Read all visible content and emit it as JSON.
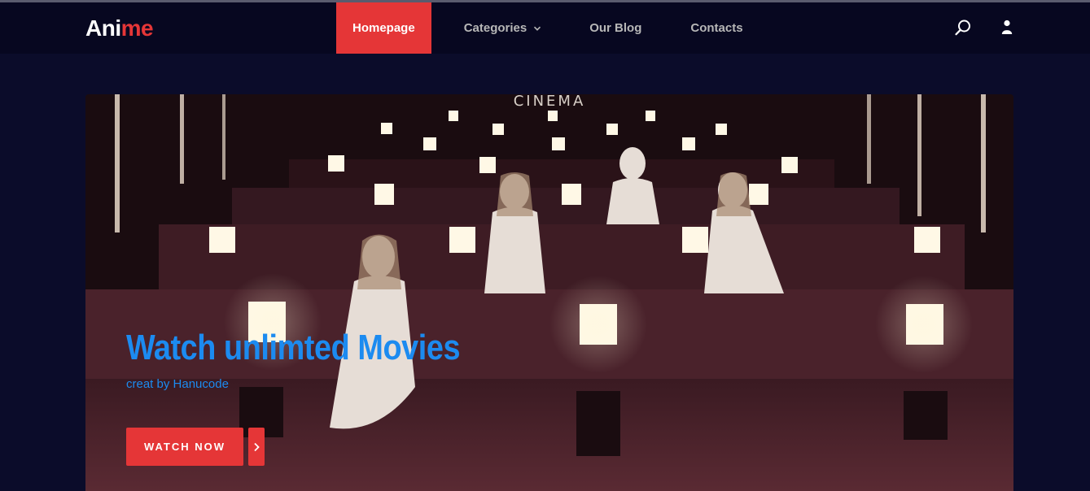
{
  "logo": {
    "part1": "Ani",
    "part2": "me"
  },
  "nav": {
    "items": [
      {
        "label": "Homepage"
      },
      {
        "label": "Categories"
      },
      {
        "label": "Our Blog"
      },
      {
        "label": "Contacts"
      }
    ]
  },
  "hero": {
    "title": "Watch unlimted Movies",
    "subtitle": "creat by Hanucode",
    "button_label": "WATCH NOW",
    "sign_text": "CINEMA"
  },
  "colors": {
    "accent": "#e53637",
    "hero_text": "#1c8bf0",
    "header_bg": "#070720",
    "page_bg": "#0b0c2a"
  },
  "icons": [
    "search-icon",
    "user-icon",
    "chevron-down-icon",
    "chevron-right-icon"
  ]
}
